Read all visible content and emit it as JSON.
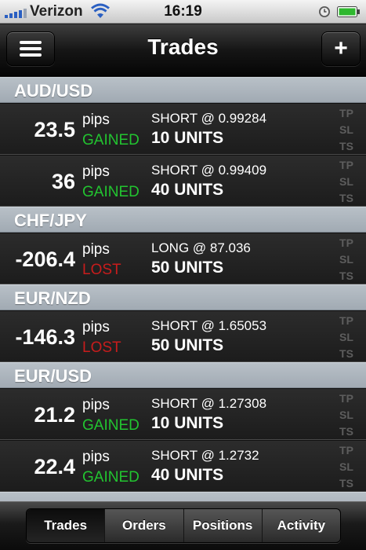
{
  "status_bar": {
    "carrier": "Verizon",
    "time": "16:19"
  },
  "navbar": {
    "title": "Trades",
    "add_label": "+"
  },
  "sections": [
    {
      "pair": "AUD/USD",
      "trades": [
        {
          "pips": "23.5",
          "pips_label": "pips",
          "result": "GAINED",
          "order": "SHORT @ 0.99284",
          "units": "10 UNITS",
          "tp": "TP",
          "sl": "SL",
          "ts": "TS"
        },
        {
          "pips": "36",
          "pips_label": "pips",
          "result": "GAINED",
          "order": "SHORT @ 0.99409",
          "units": "40 UNITS",
          "tp": "TP",
          "sl": "SL",
          "ts": "TS"
        }
      ]
    },
    {
      "pair": "CHF/JPY",
      "trades": [
        {
          "pips": "-206.4",
          "pips_label": "pips",
          "result": "LOST",
          "order": "LONG @ 87.036",
          "units": "50 UNITS",
          "tp": "TP",
          "sl": "SL",
          "ts": "TS"
        }
      ]
    },
    {
      "pair": "EUR/NZD",
      "trades": [
        {
          "pips": "-146.3",
          "pips_label": "pips",
          "result": "LOST",
          "order": "SHORT @ 1.65053",
          "units": "50 UNITS",
          "tp": "TP",
          "sl": "SL",
          "ts": "TS"
        }
      ]
    },
    {
      "pair": "EUR/USD",
      "trades": [
        {
          "pips": "21.2",
          "pips_label": "pips",
          "result": "GAINED",
          "order": "SHORT @ 1.27308",
          "units": "10 UNITS",
          "tp": "TP",
          "sl": "SL",
          "ts": "TS"
        },
        {
          "pips": "22.4",
          "pips_label": "pips",
          "result": "GAINED",
          "order": "SHORT @ 1.2732",
          "units": "40 UNITS",
          "tp": "TP",
          "sl": "SL",
          "ts": "TS"
        }
      ]
    }
  ],
  "tabs": [
    {
      "label": "Trades",
      "active": true
    },
    {
      "label": "Orders",
      "active": false
    },
    {
      "label": "Positions",
      "active": false
    },
    {
      "label": "Activity",
      "active": false
    }
  ],
  "colors": {
    "gained": "#22c430",
    "lost": "#c81c1c",
    "section_header": "#a9b2ba"
  },
  "icons": {
    "menu": "hamburger-menu-icon",
    "add": "plus-icon",
    "signal": "signal-bars-icon",
    "wifi": "wifi-icon",
    "clock": "alarm-clock-icon",
    "battery": "battery-icon"
  }
}
